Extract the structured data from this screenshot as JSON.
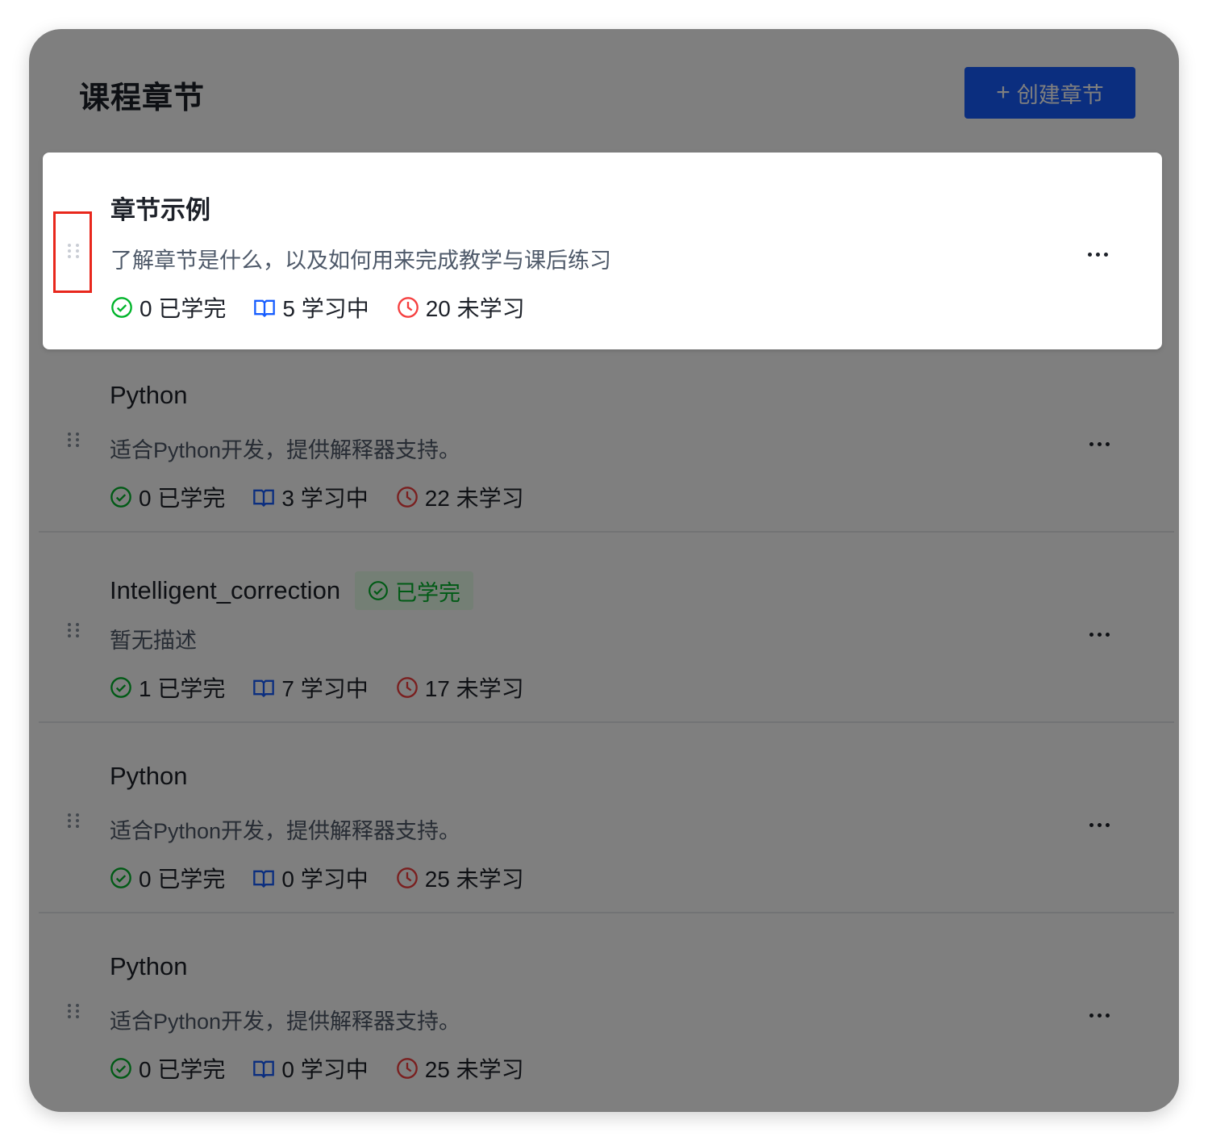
{
  "header": {
    "title": "课程章节",
    "create_button_label": "创建章节",
    "create_button_icon": "+"
  },
  "colors": {
    "primary": "#165dff",
    "completed": "#00b42a",
    "learning": "#165dff",
    "not_started": "#f53f3f",
    "highlight_border": "#e8271c"
  },
  "chapters": [
    {
      "title": "章节示例",
      "description": "了解章节是什么，以及如何用来完成教学与课后练习",
      "completed": "0 已学完",
      "learning": "5 学习中",
      "not_started": "20 未学习",
      "tag": ""
    },
    {
      "title": "Python",
      "description": "适合Python开发，提供解释器支持。",
      "completed": "0 已学完",
      "learning": "3 学习中",
      "not_started": "22 未学习",
      "tag": ""
    },
    {
      "title": "Intelligent_correction",
      "description": "暂无描述",
      "completed": "1 已学完",
      "learning": "7 学习中",
      "not_started": "17 未学习",
      "tag": "已学完"
    },
    {
      "title": "Python",
      "description": "适合Python开发，提供解释器支持。",
      "completed": "0 已学完",
      "learning": "0 学习中",
      "not_started": "25 未学习",
      "tag": ""
    },
    {
      "title": "Python",
      "description": "适合Python开发，提供解释器支持。",
      "completed": "0 已学完",
      "learning": "0 学习中",
      "not_started": "25 未学习",
      "tag": ""
    }
  ]
}
